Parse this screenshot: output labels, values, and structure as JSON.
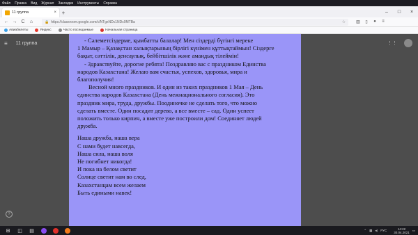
{
  "menubar": {
    "items": [
      "Файл",
      "Правка",
      "Вид",
      "Журнал",
      "Закладки",
      "Инструменты",
      "Справка"
    ]
  },
  "tab": {
    "title": "11 группа",
    "close_glyph": "×",
    "new_tab_glyph": "+"
  },
  "window_controls": {
    "minimize": "–",
    "maximize": "□",
    "close": "×"
  },
  "navbar": {
    "back": "←",
    "forward": "→",
    "reload": "C",
    "home": "⌂",
    "url": "https://classroom.google.com/c/NTgxNDc1NDc0MTBa"
  },
  "bookmarks": [
    {
      "label": "Авиабилеты",
      "color": "#3aa0e8"
    },
    {
      "label": "Яндекс",
      "color": "#e8382c"
    },
    {
      "label": "Часто посещаемые",
      "color": "#888888"
    },
    {
      "label": "Начальная страница",
      "color": "#d9312b"
    }
  ],
  "page": {
    "class_title": "11 группа",
    "menu_glyph": "≡",
    "apps_glyph": "⋮⋮",
    "help_glyph": "?"
  },
  "document": {
    "lines": [
      "- Сәлеметсіздерме, қымбатты балалар! Мен сіздерді бүгінгі мереке",
      "1 Мамыр – Қазақстан халықтарының бірлігі күнімен құттықтаймын! Сіздерге",
      "бақыт, сәттілік, денсаулық, бейбітшілік және амандық тілеймін!",
      "- Здравствуйте, дорогие ребята! Поздравляю вас с праздником Единства",
      "народов Казахстана! Желаю вам счастья, успехов, здоровья, мира и",
      "благополучия!",
      "Весной много праздников. И один из таких праздников 1 Мая – День",
      "единства народов Казахстана (День межнационального согласия). Это",
      "праздник мира, труда, дружбы. Поодиночке не сделать того, что можно",
      "сделать вместе. Один посадит дерево, а все вместе – сад. Один успеет",
      "положить только кирпич, а вместе уже построили дом! Соединяет людей",
      "дружба."
    ],
    "poem": [
      "Наша дружба, наша вера",
      "С нами будет навсегда,",
      "Наша сила, наша воля",
      "Не погибнет никогда!",
      "И пока на белом светит",
      "Солнце светит нам во след,",
      "Казахстанцам всем желаем",
      "Быть едиными навек!"
    ],
    "background": "#9a95f8"
  },
  "taskbar": {
    "start_glyph": "⊞",
    "tray_lang": "РУС",
    "time": "14:22",
    "date": "30.04.2021"
  }
}
